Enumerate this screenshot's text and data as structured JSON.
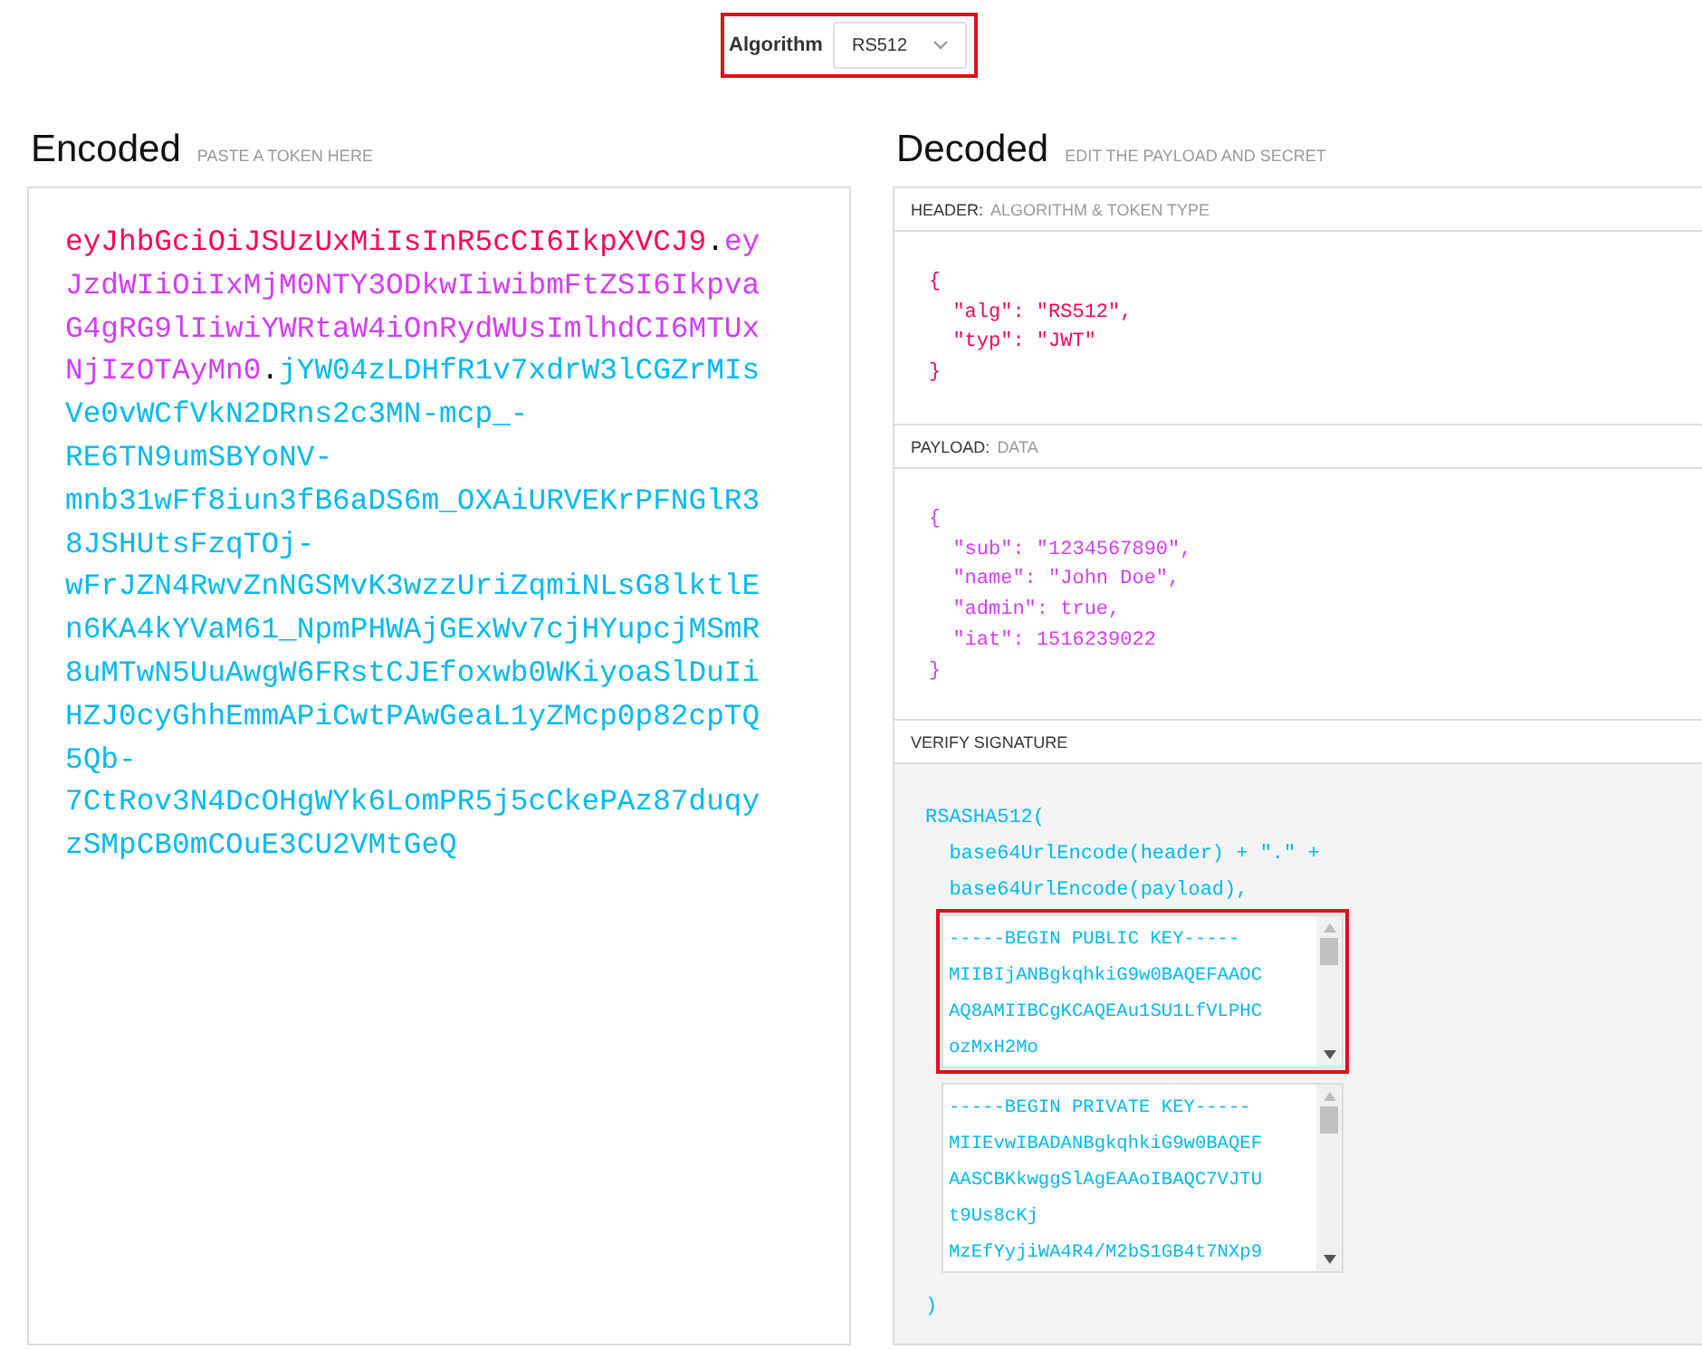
{
  "algorithm": {
    "label": "Algorithm",
    "value": "RS512",
    "highlighted": true
  },
  "encoded": {
    "title": "Encoded",
    "hint": "PASTE A TOKEN HERE",
    "lines": [
      [
        {
          "kind": "header",
          "text": "eyJhbGciOiJSUzUxMiIsInR5cCI6IkpXVCJ9"
        },
        {
          "kind": "dot",
          "text": "."
        },
        {
          "kind": "payload",
          "text": "ey"
        }
      ],
      [
        {
          "kind": "payload",
          "text": "JzdWIiOiIxMjM0NTY3ODkwIiwibmFtZSI6Ikpva"
        }
      ],
      [
        {
          "kind": "payload",
          "text": "G4gRG9lIiwiYWRtaW4iOnRydWUsImlhdCI6MTUx"
        }
      ],
      [
        {
          "kind": "payload",
          "text": "NjIzOTAyMn0"
        },
        {
          "kind": "dot",
          "text": "."
        },
        {
          "kind": "signature",
          "text": "jYW04zLDHfR1v7xdrW3lCGZrMIs"
        }
      ],
      [
        {
          "kind": "signature",
          "text": "Ve0vWCfVkN2DRns2c3MN-mcp_-"
        }
      ],
      [
        {
          "kind": "signature",
          "text": "RE6TN9umSBYoNV-"
        }
      ],
      [
        {
          "kind": "signature",
          "text": "mnb31wFf8iun3fB6aDS6m_OXAiURVEKrPFNGlR3"
        }
      ],
      [
        {
          "kind": "signature",
          "text": "8JSHUtsFzqTOj-"
        }
      ],
      [
        {
          "kind": "signature",
          "text": "wFrJZN4RwvZnNGSMvK3wzzUriZqmiNLsG8lktlE"
        }
      ],
      [
        {
          "kind": "signature",
          "text": "n6KA4kYVaM61_NpmPHWAjGExWv7cjHYupcjMSmR"
        }
      ],
      [
        {
          "kind": "signature",
          "text": "8uMTwN5UuAwgW6FRstCJEfoxwb0WKiyoaSlDuIi"
        }
      ],
      [
        {
          "kind": "signature",
          "text": "HZJ0cyGhhEmmAPiCwtPAwGeaL1yZMcp0p82cpTQ"
        }
      ],
      [
        {
          "kind": "signature",
          "text": "5Qb-"
        }
      ],
      [
        {
          "kind": "signature",
          "text": "7CtRov3N4DcOHgWYk6LomPR5j5cCkePAz87duqy"
        }
      ],
      [
        {
          "kind": "signature",
          "text": "zSMpCB0mCOuE3CU2VMtGeQ"
        }
      ]
    ]
  },
  "decoded": {
    "title": "Decoded",
    "hint": "EDIT THE PAYLOAD AND SECRET",
    "header": {
      "label": "HEADER:",
      "sublabel": "ALGORITHM & TOKEN TYPE",
      "lines": [
        "{",
        "  \"alg\": \"RS512\",",
        "  \"typ\": \"JWT\"",
        "}"
      ]
    },
    "payload": {
      "label": "PAYLOAD:",
      "sublabel": "DATA",
      "lines": [
        "{",
        "  \"sub\": \"1234567890\",",
        "  \"name\": \"John Doe\",",
        "  \"admin\": true,",
        "  \"iat\": 1516239022",
        "}"
      ]
    },
    "verify": {
      "label": "VERIFY SIGNATURE",
      "lines": [
        "RSASHA512(",
        "  base64UrlEncode(header) + \".\" +",
        "  base64UrlEncode(payload),"
      ],
      "keys": [
        {
          "highlighted": true,
          "lines": [
            "-----BEGIN PUBLIC KEY-----",
            "MIIBIjANBgkqhkiG9w0BAQEFAAOC",
            "AQ8AMIIBCgKCAQEAu1SU1LfVLPHC",
            "ozMxH2Mo"
          ]
        },
        {
          "highlighted": false,
          "lines": [
            "-----BEGIN PRIVATE KEY-----",
            "MIIEvwIBADANBgkqhkiG9w0BAQEF",
            "AASCBKkwggSlAgEAAoIBAQC7VJTU",
            "t9Us8cKj",
            "MzEfYyjiWA4R4/M2bS1GB4t7NXp9"
          ]
        }
      ],
      "closing": ")"
    }
  }
}
